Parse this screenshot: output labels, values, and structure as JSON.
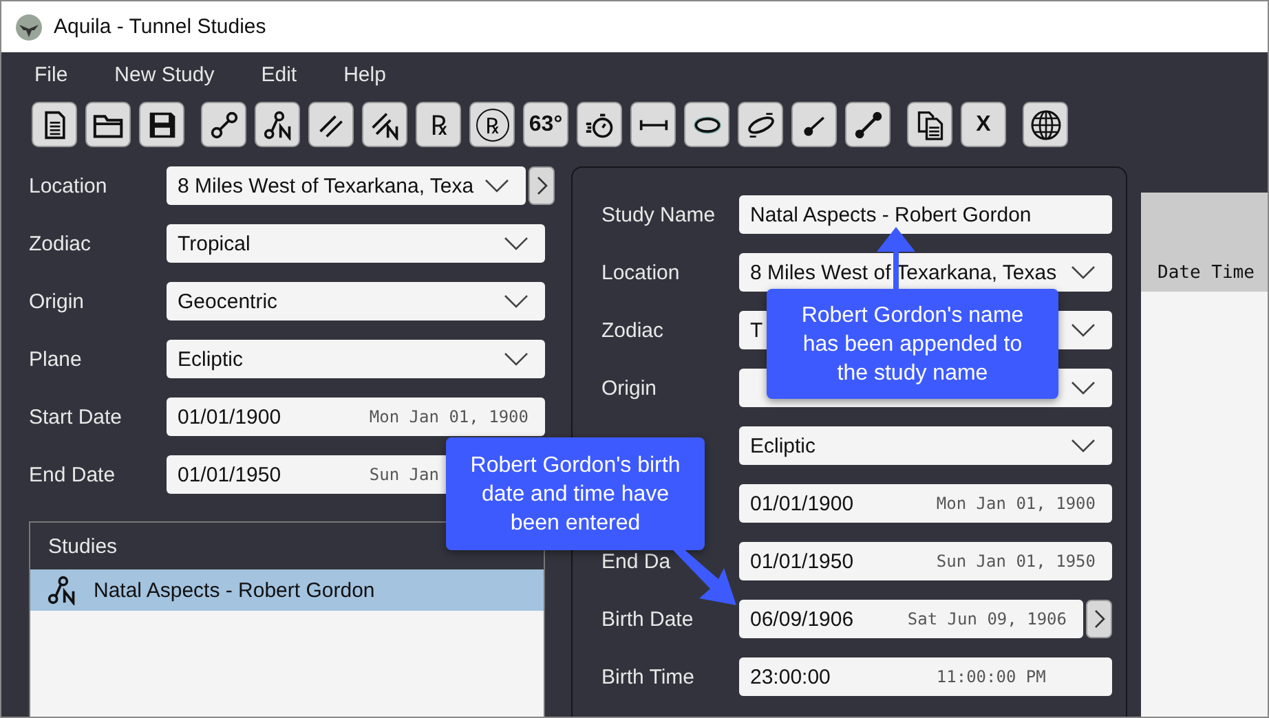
{
  "window": {
    "title": "Aquila - Tunnel Studies"
  },
  "menu": [
    "File",
    "New Study",
    "Edit",
    "Help"
  ],
  "toolbar": [
    {
      "buttons": [
        {
          "kind": "icon"
        },
        {
          "kind": "icon"
        },
        {
          "kind": "icon"
        }
      ]
    },
    {
      "buttons": [
        {
          "kind": "icon"
        },
        {
          "kind": "icon"
        },
        {
          "kind": "icon"
        },
        {
          "kind": "icon"
        },
        {
          "kind": "text",
          "label": "℞"
        },
        {
          "kind": "circled-text",
          "label": "℞"
        },
        {
          "kind": "text",
          "label": "63°"
        },
        {
          "kind": "icon"
        },
        {
          "kind": "icon"
        },
        {
          "kind": "icon"
        },
        {
          "kind": "icon"
        },
        {
          "kind": "icon"
        },
        {
          "kind": "icon"
        }
      ]
    },
    {
      "buttons": [
        {
          "kind": "icon"
        },
        {
          "kind": "text",
          "label": "X"
        }
      ]
    },
    {
      "buttons": [
        {
          "kind": "icon"
        }
      ]
    }
  ],
  "left_form": [
    {
      "label": "Location",
      "kind": "dropdown",
      "value": "8 Miles West of Texarkana, Texa",
      "next_button": true
    },
    {
      "label": "Zodiac",
      "kind": "dropdown",
      "value": "Tropical",
      "next_button": false
    },
    {
      "label": "Origin",
      "kind": "dropdown",
      "value": "Geocentric",
      "next_button": false
    },
    {
      "label": "Plane",
      "kind": "dropdown",
      "value": "Ecliptic",
      "next_button": false
    },
    {
      "label": "Start Date",
      "kind": "date",
      "value": "01/01/1900",
      "hint": "Mon Jan 01, 1900",
      "next_button": false
    },
    {
      "label": "End Date",
      "kind": "date",
      "value": "01/01/1950",
      "hint": "Sun Jan",
      "next_button": false
    }
  ],
  "studies": {
    "title": "Studies",
    "items": [
      {
        "name": "Natal Aspects - Robert Gordon",
        "selected": true
      }
    ]
  },
  "study_form": [
    {
      "label": "Study Name",
      "kind": "text",
      "value": "Natal Aspects - Robert Gordon",
      "next_button": false
    },
    {
      "label": "Location",
      "kind": "dropdown",
      "value": "8 Miles West of Texarkana, Texas",
      "next_button": false
    },
    {
      "label": "Zodiac",
      "kind": "dropdown",
      "value": "T",
      "next_button": false
    },
    {
      "label": "Origin",
      "kind": "dropdown",
      "next_button": false
    },
    {
      "kind": "dropdown",
      "value": "Ecliptic",
      "next_button": false
    },
    {
      "kind": "date",
      "value": "01/01/1900",
      "hint": "Mon Jan 01, 1900",
      "next_button": false
    },
    {
      "label": "End Da",
      "kind": "date",
      "value": "01/01/1950",
      "hint": "Sun Jan 01, 1950",
      "next_button": false
    },
    {
      "label": "Birth Date",
      "kind": "date",
      "value": "06/09/1906",
      "hint": "Sat Jun 09, 1906",
      "next_button": true
    },
    {
      "label": "Birth Time",
      "kind": "date",
      "value": "23:00:00",
      "hint": "11:00:00 PM",
      "next_button": false
    }
  ],
  "table": {
    "columns": [
      "Date Time"
    ]
  },
  "annotations": [
    {
      "text": "Robert Gordon's name has been appended to the study name"
    },
    {
      "text": "Robert Gordon's birth date and time have been entered"
    }
  ]
}
